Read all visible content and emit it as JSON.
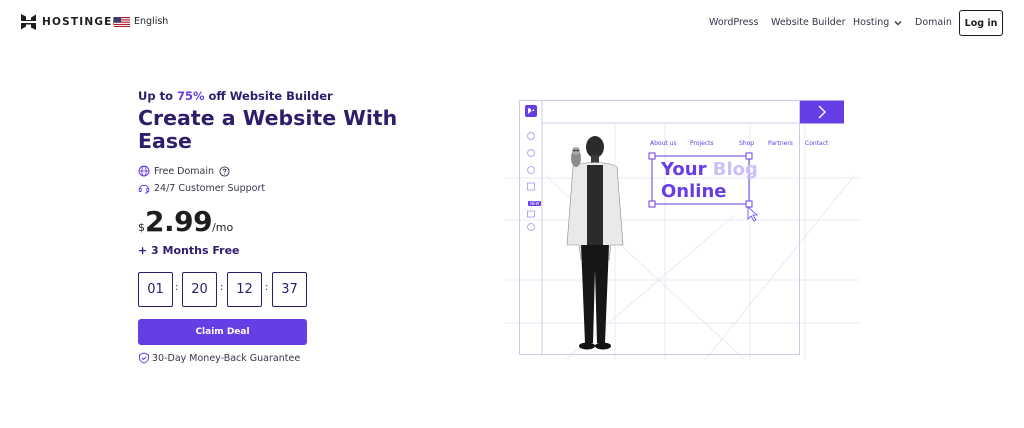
{
  "header": {
    "brand": "HOSTINGER",
    "language": "English",
    "nav": [
      "WordPress",
      "Website Builder",
      "Hosting",
      "Domain"
    ],
    "login_label": "Log in"
  },
  "hero": {
    "promo_prefix": "Up to ",
    "promo_percent": "75%",
    "promo_suffix": " off Website Builder",
    "title": "Create a Website With Ease",
    "features": [
      "Free Domain",
      "24/7 Customer Support"
    ],
    "price": {
      "currency": "$",
      "amount": "2.99",
      "period": "/mo"
    },
    "bonus": "+ 3 Months Free",
    "timer": [
      "01",
      "20",
      "12",
      "37"
    ],
    "timer_separator": ":",
    "cta_label": "Claim Deal",
    "guarantee": "30-Day Money-Back Guarantee"
  },
  "illustration": {
    "nav_links": [
      "About us",
      "Projects",
      "Shop",
      "Partners",
      "Contact"
    ],
    "headline_word1": "Your",
    "headline_word2": "Blog",
    "headline_word3": "Online",
    "new_badge": "NEW"
  },
  "colors": {
    "accent": "#673de6",
    "heading": "#2f1c6a",
    "text": "#36344d"
  }
}
